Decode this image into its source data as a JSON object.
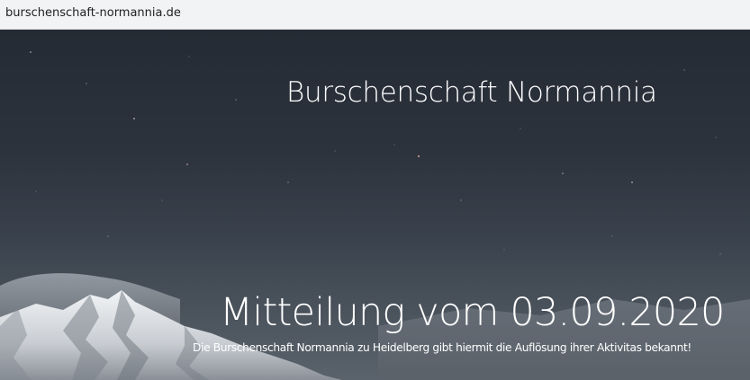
{
  "browser": {
    "url": "burschenschaft-normannia.de"
  },
  "hero": {
    "site_title": "Burschenschaft Normannia",
    "announcement_title": "Mitteilung vom 03.09.2020",
    "announcement_text": "Die Burschenschaft Normannia zu Heidelberg gibt hiermit die Auflösung ihrer Aktivitas bekannt!",
    "background_image": "starry-night-mountain-landscape"
  },
  "colors": {
    "sky_top": "#252b34",
    "sky_bottom": "#5a626b",
    "text": "#ffffff",
    "address_bar": "#f1f3f4"
  }
}
